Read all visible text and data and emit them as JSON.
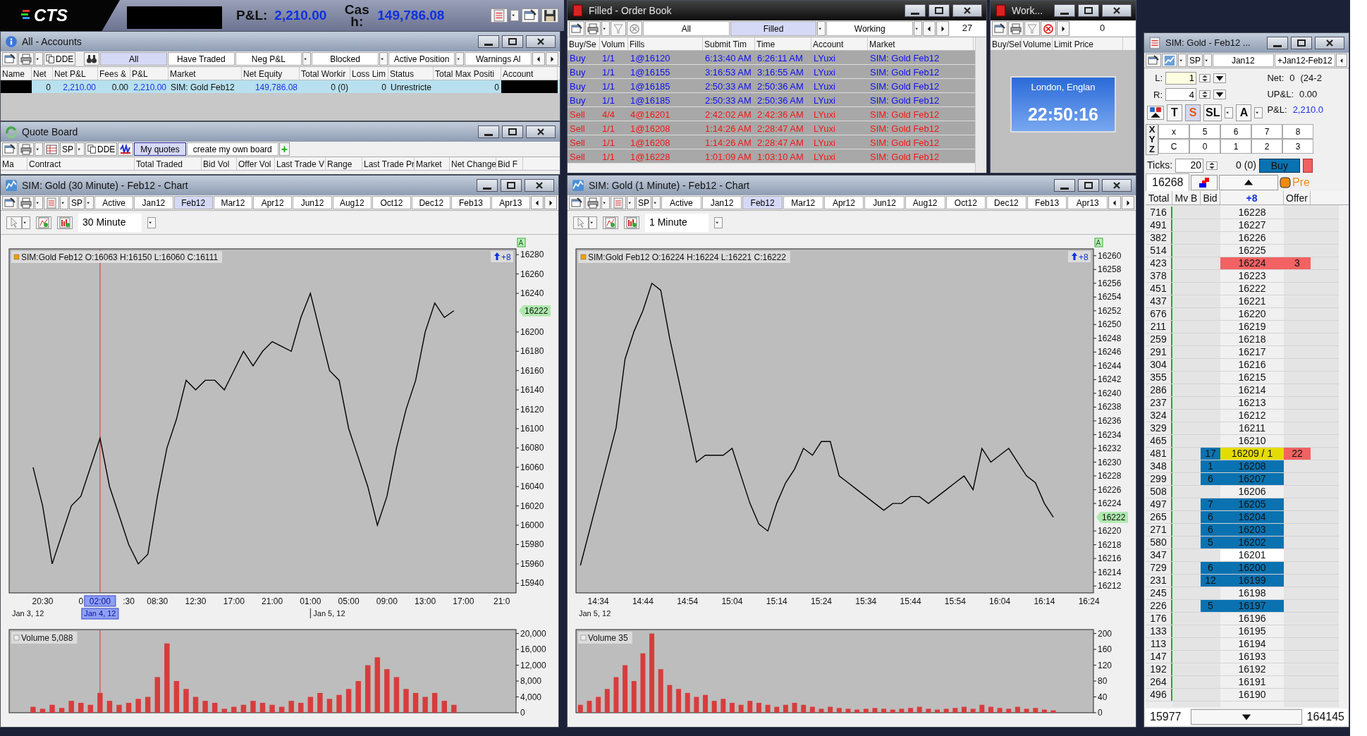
{
  "top_bar": {
    "logo": "CTS",
    "pnl_label": "P&L:",
    "pnl": "2,210.00",
    "cash_label": "Cash:",
    "cash": "149,786.08"
  },
  "accounts": {
    "title": "All - Accounts",
    "dde": "DDE",
    "filters": [
      {
        "label": "All",
        "selected": true,
        "dropdown": false
      },
      {
        "label": "Have Traded",
        "selected": false,
        "dropdown": false
      },
      {
        "label": "Neg P&L",
        "selected": false,
        "dropdown": true
      },
      {
        "label": "Blocked",
        "selected": false,
        "dropdown": true
      },
      {
        "label": "Active Position",
        "selected": false,
        "dropdown": true
      },
      {
        "label": "Warnings Al",
        "selected": false,
        "dropdown": false
      }
    ],
    "columns": [
      "Name",
      "Net",
      "Net P&L",
      "Fees &",
      "P&L",
      "Market",
      "Net Equity",
      "Total Workir",
      "Loss Lim",
      "Status",
      "Total Max Positi",
      "Account"
    ],
    "rows": [
      {
        "cells": [
          {
            "kind": "redacted"
          },
          {
            "kind": "number",
            "text": "0"
          },
          {
            "kind": "money",
            "text": "2,210.00"
          },
          {
            "kind": "number",
            "text": "0.00"
          },
          {
            "kind": "money",
            "text": "2,210.00"
          },
          {
            "kind": "text",
            "text": "SIM: Gold Feb12"
          },
          {
            "kind": "money",
            "text": "149,786.08"
          },
          {
            "kind": "number",
            "text": "0 (0)"
          },
          {
            "kind": "number",
            "text": "0"
          },
          {
            "kind": "text",
            "text": "Unrestricte"
          },
          {
            "kind": "number",
            "text": "0"
          },
          {
            "kind": "redacted"
          }
        ]
      }
    ]
  },
  "quote_board": {
    "title": "Quote Board",
    "sp": "SP",
    "dde": "DDE",
    "boards": [
      {
        "label": "My quotes",
        "selected": true
      },
      {
        "label": "create my own board",
        "selected": false
      }
    ],
    "add": "+",
    "columns": [
      "Ma",
      "Contract",
      "Total Traded",
      "Bid Vol",
      "Offer Vol",
      "Last Trade V",
      "Range",
      "Last Trade Pr",
      "Market",
      "Net Change",
      "Bid F"
    ]
  },
  "order_book": {
    "title": "Filled - Order Book",
    "filters": [
      {
        "label": "All",
        "selected": false,
        "dropdown": false
      },
      {
        "label": "Filled",
        "selected": true,
        "dropdown": true
      },
      {
        "label": "Working",
        "selected": false,
        "dropdown": true
      }
    ],
    "count": "27",
    "columns": [
      "Buy/Se",
      "Volum",
      "Fills",
      "Submit Tim",
      "Time",
      "Account",
      "Market"
    ],
    "rows": [
      {
        "color": "#1010f0",
        "cells": [
          "Buy",
          "1/1",
          "1@16120",
          "6:13:40 AM",
          "6:26:11 AM",
          "LYuxi",
          "SIM: Gold Feb12"
        ]
      },
      {
        "color": "#1010f0",
        "cells": [
          "Buy",
          "1/1",
          "1@16155",
          "3:16:53 AM",
          "3:16:55 AM",
          "LYuxi",
          "SIM: Gold Feb12"
        ]
      },
      {
        "color": "#1010f0",
        "cells": [
          "Buy",
          "1/1",
          "1@16185",
          "2:50:33 AM",
          "2:50:36 AM",
          "LYuxi",
          "SIM: Gold Feb12"
        ]
      },
      {
        "color": "#1010f0",
        "cells": [
          "Buy",
          "1/1",
          "1@16185",
          "2:50:33 AM",
          "2:50:36 AM",
          "LYuxi",
          "SIM: Gold Feb12"
        ]
      },
      {
        "color": "#f01818",
        "cells": [
          "Sell",
          "4/4",
          "4@16201",
          "2:42:02 AM",
          "2:42:36 AM",
          "LYuxi",
          "SIM: Gold Feb12"
        ]
      },
      {
        "color": "#f01818",
        "cells": [
          "Sell",
          "1/1",
          "1@16208",
          "1:14:26 AM",
          "2:28:47 AM",
          "LYuxi",
          "SIM: Gold Feb12"
        ]
      },
      {
        "color": "#f01818",
        "cells": [
          "Sell",
          "1/1",
          "1@16208",
          "1:14:26 AM",
          "2:28:47 AM",
          "LYuxi",
          "SIM: Gold Feb12"
        ]
      },
      {
        "color": "#f01818",
        "cells": [
          "Sell",
          "1/1",
          "1@16228",
          "1:01:09 AM",
          "1:03:10 AM",
          "LYuxi",
          "SIM: Gold Feb12"
        ]
      }
    ]
  },
  "working": {
    "title": "Work...",
    "count": "0",
    "columns": [
      "Buy/Sel",
      "Volume",
      "Limit Price"
    ],
    "clock": {
      "city": "London, Englan",
      "time": "22:50:16"
    }
  },
  "charts": [
    {
      "title": "SIM: Gold (30 Minute) - Feb12 - Chart",
      "sp": "SP",
      "contracts": [
        {
          "label": "Active",
          "selected": false
        },
        {
          "label": "Jan12",
          "selected": false
        },
        {
          "label": "Feb12",
          "selected": true
        },
        {
          "label": "Mar12",
          "selected": false
        },
        {
          "label": "Apr12",
          "selected": false
        },
        {
          "label": "Jun12",
          "selected": false
        },
        {
          "label": "Aug12",
          "selected": false
        },
        {
          "label": "Oct12",
          "selected": false
        },
        {
          "label": "Dec12",
          "selected": false
        },
        {
          "label": "Feb13",
          "selected": false
        },
        {
          "label": "Apr13",
          "selected": false
        }
      ],
      "interval": "30 Minute",
      "change": "+8",
      "auto": "A",
      "last_price": "16222",
      "dates": [
        {
          "label": "Jan 3, 12",
          "selected": false
        },
        {
          "label": "Jan 4, 12",
          "selected": true
        },
        {
          "label": "Jan 5, 12",
          "selected": false
        }
      ],
      "price_panel": {
        "chart_data": {
          "type": "line",
          "title": "SIM:Gold Feb12 O:16063 H:16150 L:16060 C:16111",
          "categories": [
            null,
            null,
            null,
            "20:30",
            null,
            null,
            null,
            "0",
            null,
            "02:00",
            null,
            null,
            ":30",
            null,
            null,
            "08:30",
            null,
            null,
            null,
            "12:30",
            null,
            null,
            null,
            "17:00",
            null,
            null,
            null,
            "21:00",
            null,
            null,
            null,
            "01:00",
            null,
            null,
            null,
            "05:00",
            null,
            null,
            null,
            "09:00",
            null,
            null,
            null,
            "13:00",
            null,
            null,
            null,
            "17:00",
            null,
            null,
            null,
            "21:0",
            null
          ],
          "series": [
            {
              "color": "#000000",
              "values": [
                null,
                null,
                16060,
                16020,
                15960,
                15990,
                16020,
                16030,
                16060,
                16090,
                16040,
                16010,
                15980,
                15960,
                15970,
                16030,
                16080,
                16110,
                16150,
                16140,
                16150,
                16150,
                16140,
                16160,
                16180,
                16165,
                16180,
                16190,
                16185,
                16180,
                16215,
                16240,
                16200,
                16160,
                16150,
                16100,
                16070,
                16040,
                16000,
                16030,
                16080,
                16120,
                16150,
                16200,
                16230,
                16215,
                16222,
                null,
                null,
                null,
                null,
                null,
                null
              ]
            }
          ],
          "ylim": [
            15930,
            16286
          ],
          "yticks": [
            15940,
            15960,
            15980,
            16000,
            16020,
            16040,
            16060,
            16080,
            16100,
            16120,
            16140,
            16160,
            16180,
            16200,
            16240,
            16260,
            16280
          ]
        }
      },
      "volume_panel": {
        "chart_data": {
          "type": "bar",
          "title": "Volume 5,088",
          "categories": [
            null,
            null,
            null,
            null,
            null,
            null,
            null,
            null,
            null,
            null,
            null,
            null,
            null,
            null,
            null,
            null,
            null,
            null,
            null,
            null,
            null,
            null,
            null,
            null,
            null,
            null,
            null,
            null,
            null,
            null,
            null,
            null,
            null,
            null,
            null,
            null,
            null,
            null,
            null,
            null,
            null,
            null,
            null,
            null,
            null,
            null,
            null,
            null,
            null,
            null,
            null,
            null,
            null
          ],
          "series": [
            {
              "color": "#d83c3c",
              "values": [
                null,
                null,
                1500,
                1000,
                2000,
                1200,
                3000,
                2500,
                2000,
                5000,
                3000,
                2000,
                2500,
                3500,
                4000,
                9000,
                17500,
                8000,
                6000,
                4000,
                3000,
                2500,
                1000,
                1500,
                2000,
                3000,
                2500,
                2000,
                1500,
                3000,
                2500,
                4000,
                5000,
                3500,
                4500,
                6000,
                8000,
                12000,
                14000,
                11000,
                9000,
                6000,
                5000,
                4000,
                5000,
                3000,
                2000,
                null,
                null,
                null,
                null,
                null,
                null
              ]
            }
          ],
          "ylim": [
            0,
            21000
          ],
          "yticks": [
            {
              "value": 0,
              "label": "0"
            },
            {
              "value": 4000,
              "label": "4,000"
            },
            {
              "value": 8000,
              "label": "8,000"
            },
            {
              "value": 12000,
              "label": "12,000"
            },
            {
              "value": 16000,
              "label": "16,000"
            },
            {
              "value": 20000,
              "label": "20,000"
            }
          ]
        }
      }
    },
    {
      "title": "SIM: Gold (1 Minute) - Feb12 - Chart",
      "sp": "SP",
      "contracts": [
        {
          "label": "Active",
          "selected": false
        },
        {
          "label": "Jan12",
          "selected": false
        },
        {
          "label": "Feb12",
          "selected": true
        },
        {
          "label": "Mar12",
          "selected": false
        },
        {
          "label": "Apr12",
          "selected": false
        },
        {
          "label": "Jun12",
          "selected": false
        },
        {
          "label": "Aug12",
          "selected": false
        },
        {
          "label": "Oct12",
          "selected": false
        },
        {
          "label": "Dec12",
          "selected": false
        },
        {
          "label": "Feb13",
          "selected": false
        },
        {
          "label": "Apr13",
          "selected": false
        }
      ],
      "interval": "1 Minute",
      "change": "+8",
      "auto": "A",
      "last_price": "16222",
      "dates": [
        {
          "label": "Jan 5, 12",
          "selected": false
        }
      ],
      "price_panel": {
        "chart_data": {
          "type": "line",
          "title": "SIM:Gold Feb12 O:16224 H:16224 L:16221 C:16222",
          "categories": [
            null,
            null,
            "14:34",
            null,
            null,
            null,
            null,
            "14:44",
            null,
            null,
            null,
            null,
            "14:54",
            null,
            null,
            null,
            null,
            "15:04",
            null,
            null,
            null,
            null,
            "15:14",
            null,
            null,
            null,
            null,
            "15:24",
            null,
            null,
            null,
            null,
            "15:34",
            null,
            null,
            null,
            null,
            "15:44",
            null,
            null,
            null,
            null,
            "15:54",
            null,
            null,
            null,
            null,
            "16:04",
            null,
            null,
            null,
            null,
            "16:14",
            null,
            null,
            null,
            null,
            "16:24"
          ],
          "series": [
            {
              "color": "#000000",
              "values": [
                16215,
                16220,
                16225,
                16230,
                16235,
                16245,
                16249,
                16252,
                16256,
                16255,
                16248,
                16242,
                16236,
                16230,
                16231,
                16231,
                16231,
                16232,
                16228,
                16224,
                16221,
                16220,
                16224,
                16227,
                16229,
                16232,
                16231,
                16233,
                16233,
                16228,
                16227,
                16226,
                16225,
                16224,
                16223,
                16224,
                16224,
                16225,
                16225,
                16224,
                16225,
                16226,
                16227,
                16228,
                16226,
                16232,
                16230,
                16231,
                16232,
                16230,
                16228,
                16227,
                16224,
                16222,
                null,
                null,
                null,
                null
              ]
            }
          ],
          "ylim": [
            16211,
            16261
          ],
          "yticks": [
            16212,
            16214,
            16216,
            16218,
            16220,
            16224,
            16226,
            16228,
            16230,
            16232,
            16234,
            16236,
            16238,
            16240,
            16242,
            16244,
            16246,
            16248,
            16250,
            16252,
            16254,
            16256,
            16258,
            16260
          ]
        }
      },
      "volume_panel": {
        "chart_data": {
          "type": "bar",
          "title": "Volume 35",
          "categories": [
            null,
            null,
            null,
            null,
            null,
            null,
            null,
            null,
            null,
            null,
            null,
            null,
            null,
            null,
            null,
            null,
            null,
            null,
            null,
            null,
            null,
            null,
            null,
            null,
            null,
            null,
            null,
            null,
            null,
            null,
            null,
            null,
            null,
            null,
            null,
            null,
            null,
            null,
            null,
            null,
            null,
            null,
            null,
            null,
            null,
            null,
            null,
            null,
            null,
            null,
            null,
            null,
            null,
            null,
            null,
            null,
            null,
            null
          ],
          "series": [
            {
              "color": "#d83c3c",
              "values": [
                20,
                30,
                40,
                60,
                90,
                120,
                80,
                150,
                200,
                110,
                70,
                60,
                50,
                40,
                45,
                30,
                35,
                25,
                20,
                30,
                25,
                20,
                15,
                20,
                25,
                20,
                15,
                10,
                15,
                12,
                10,
                8,
                10,
                12,
                10,
                8,
                10,
                12,
                15,
                10,
                8,
                10,
                12,
                15,
                10,
                20,
                15,
                12,
                10,
                15,
                10,
                12,
                8,
                6,
                null,
                null,
                null,
                null
              ]
            }
          ],
          "ylim": [
            0,
            210
          ],
          "yticks": [
            0,
            40,
            80,
            120,
            160,
            200
          ]
        }
      }
    }
  ],
  "dom": {
    "title": "SIM: Gold - Feb12 ...",
    "sp": "SP",
    "contracts": [
      "Jan12",
      "+Jan12-Feb12"
    ],
    "quantities": [
      {
        "label": "L:",
        "value": "1"
      },
      {
        "label": "R:",
        "value": "4"
      }
    ],
    "stats": [
      {
        "label": "Net:",
        "value": "0",
        "extra": "(24-2",
        "kind": "plain"
      },
      {
        "label": "UP&L:",
        "value": "0.00",
        "kind": "plain"
      },
      {
        "label": "P&L:",
        "value": "2,210.0",
        "kind": "money"
      }
    ],
    "order_types": [
      {
        "label": "T",
        "selected": false,
        "dropdown": false
      },
      {
        "label": "S",
        "selected": true,
        "dropdown": false
      },
      {
        "label": "SL",
        "selected": false,
        "dropdown": true
      },
      {
        "label": "A",
        "selected": false,
        "dropdown": true
      }
    ],
    "axis_labels": [
      "X",
      "Y",
      "Z"
    ],
    "key_rows": [
      [
        "x",
        "5",
        "6",
        "7",
        "8"
      ],
      [
        "C",
        "0",
        "1",
        "2",
        "3"
      ]
    ],
    "ticks_label": "Ticks:",
    "ticks": "20",
    "position": "0 (0)",
    "buy": "Buy",
    "price_field": "16268",
    "pre": "Pre",
    "columns": [
      "Total",
      "Mv B",
      "Bid",
      "+8",
      "Offer"
    ],
    "rows": [
      {
        "total": "716",
        "price": "16228",
        "kind": "plain"
      },
      {
        "total": "491",
        "price": "16227",
        "kind": "plain"
      },
      {
        "total": "382",
        "price": "16226",
        "kind": "plain"
      },
      {
        "total": "514",
        "price": "16225",
        "kind": "plain"
      },
      {
        "total": "423",
        "price": "16224",
        "offer": "3",
        "kind": "ask"
      },
      {
        "total": "378",
        "price": "16223",
        "kind": "plain"
      },
      {
        "total": "451",
        "price": "16222",
        "kind": "plain"
      },
      {
        "total": "437",
        "price": "16221",
        "kind": "plain"
      },
      {
        "total": "676",
        "price": "16220",
        "kind": "plain"
      },
      {
        "total": "211",
        "price": "16219",
        "kind": "plain"
      },
      {
        "total": "259",
        "price": "16218",
        "kind": "plain"
      },
      {
        "total": "291",
        "price": "16217",
        "kind": "plain"
      },
      {
        "total": "304",
        "price": "16216",
        "kind": "plain"
      },
      {
        "total": "355",
        "price": "16215",
        "kind": "plain"
      },
      {
        "total": "286",
        "price": "16214",
        "kind": "plain"
      },
      {
        "total": "237",
        "price": "16213",
        "kind": "plain"
      },
      {
        "total": "324",
        "price": "16212",
        "kind": "plain"
      },
      {
        "total": "329",
        "price": "16211",
        "kind": "plain"
      },
      {
        "total": "465",
        "price": "16210",
        "kind": "plain"
      },
      {
        "total": "481",
        "bid": "17",
        "price": "16209 / 1",
        "offer": "22",
        "kind": "last"
      },
      {
        "total": "348",
        "bid": "1",
        "price": "16208",
        "kind": "bid"
      },
      {
        "total": "299",
        "bid": "6",
        "price": "16207",
        "kind": "bid"
      },
      {
        "total": "508",
        "price": "16206",
        "kind": "plain"
      },
      {
        "total": "497",
        "bid": "7",
        "price": "16205",
        "kind": "bid"
      },
      {
        "total": "265",
        "bid": "6",
        "price": "16204",
        "kind": "bid"
      },
      {
        "total": "271",
        "bid": "6",
        "price": "16203",
        "kind": "bid"
      },
      {
        "total": "580",
        "bid": "5",
        "price": "16202",
        "kind": "bid"
      },
      {
        "total": "347",
        "price": "16201",
        "kind": "entry"
      },
      {
        "total": "729",
        "bid": "6",
        "price": "16200",
        "kind": "bid"
      },
      {
        "total": "231",
        "bid": "12",
        "price": "16199",
        "kind": "bid"
      },
      {
        "total": "245",
        "price": "16198",
        "kind": "plain"
      },
      {
        "total": "226",
        "bid": "5",
        "price": "16197",
        "kind": "bid"
      },
      {
        "total": "176",
        "price": "16196",
        "kind": "plain"
      },
      {
        "total": "133",
        "price": "16195",
        "kind": "plain"
      },
      {
        "total": "113",
        "price": "16194",
        "kind": "plain"
      },
      {
        "total": "147",
        "price": "16193",
        "kind": "plain"
      },
      {
        "total": "192",
        "price": "16192",
        "kind": "plain"
      },
      {
        "total": "264",
        "price": "16191",
        "kind": "plain"
      },
      {
        "total": "496",
        "price": "16190",
        "kind": "plain"
      }
    ],
    "footer": {
      "low": "15977",
      "high": "164145"
    }
  }
}
